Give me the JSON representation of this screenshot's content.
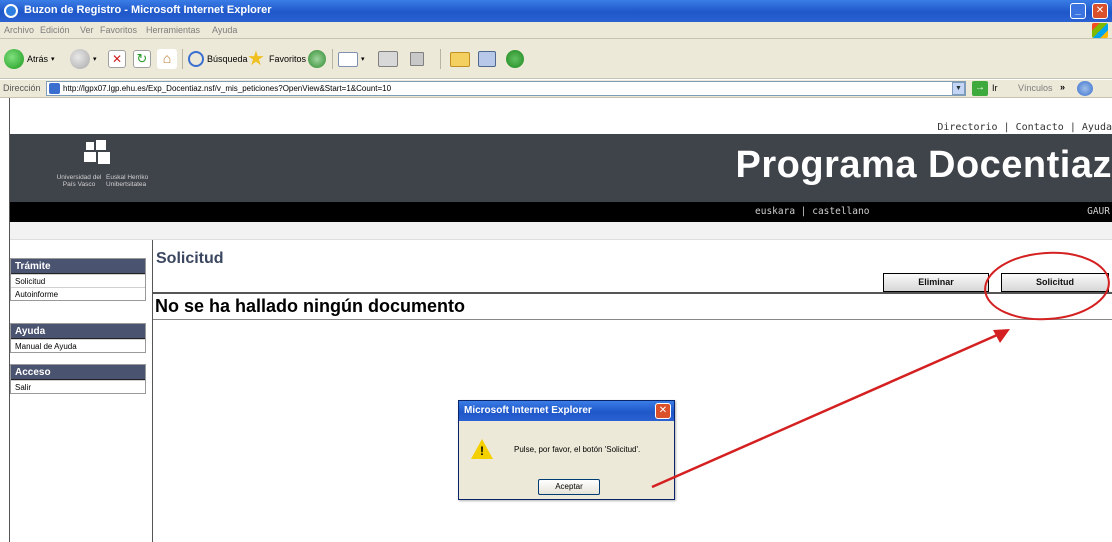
{
  "window": {
    "title": "Buzon de Registro - Microsoft Internet Explorer"
  },
  "menubar": {
    "items": [
      "Archivo",
      "Edición",
      "Ver",
      "Favoritos",
      "Herramientas",
      "Ayuda"
    ]
  },
  "toolbar": {
    "back_label": "Atrás",
    "search_label": "Búsqueda",
    "favorites_label": "Favoritos"
  },
  "addressbar": {
    "label": "Dirección",
    "url": "http://lgpx07.lgp.ehu.es/Exp_Docentiaz.nsf/v_mis_peticiones?OpenView&Start=1&Count=10",
    "go_label": "Ir",
    "links_label": "Vínculos"
  },
  "header": {
    "links": [
      "Directorio",
      "Contacto",
      "Ayuda"
    ],
    "logo_text_left": "Universidad del País Vasco",
    "logo_text_right": "Euskal Herriko Unibertsitatea",
    "program_title": "Programa Docentiaz",
    "languages": [
      "euskara",
      "castellano"
    ],
    "gaur": "GAUR"
  },
  "sidebar": {
    "groups": [
      {
        "title": "Trámite",
        "items": [
          "Solicitud",
          "Autoinforme"
        ]
      },
      {
        "title": "Ayuda",
        "items": [
          "Manual de Ayuda"
        ]
      },
      {
        "title": "Acceso",
        "items": [
          "Salir"
        ]
      }
    ]
  },
  "main": {
    "section_title": "Solicitud",
    "delete_button": "Eliminar",
    "request_button": "Solicitud",
    "empty_message": "No se ha hallado ningún documento"
  },
  "dialog": {
    "title": "Microsoft Internet Explorer",
    "message": "Pulse, por favor, el botón 'Solicitud'.",
    "ok_button": "Aceptar"
  },
  "colors": {
    "title_bar": "#1f57c9",
    "banner": "#3f434a",
    "nav_header": "#4a5370",
    "annotation": "#d42020"
  },
  "icons": {
    "ie": "ie-logo-icon",
    "back": "back-arrow-icon",
    "forward": "forward-arrow-icon",
    "warning": "warning-icon"
  }
}
